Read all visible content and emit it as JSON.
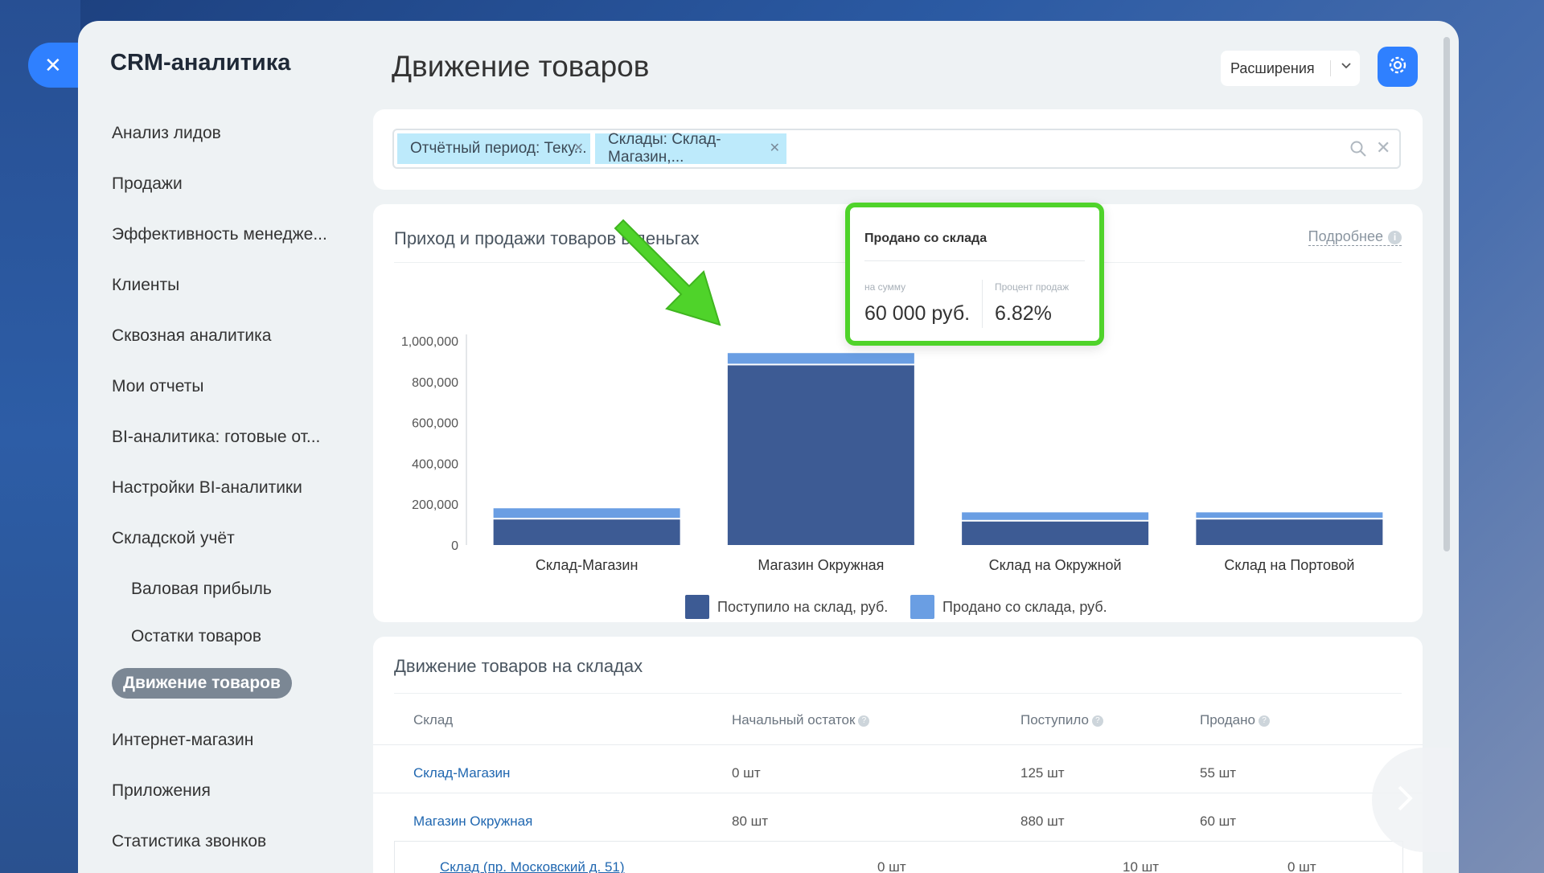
{
  "app": {
    "title": "CRM-аналитика"
  },
  "sidebar": {
    "items": [
      {
        "label": "Анализ лидов"
      },
      {
        "label": "Продажи"
      },
      {
        "label": "Эффективность менедже..."
      },
      {
        "label": "Клиенты"
      },
      {
        "label": "Сквозная аналитика"
      },
      {
        "label": "Мои отчеты"
      },
      {
        "label": "BI-аналитика: готовые от..."
      },
      {
        "label": "Настройки BI-аналитики"
      },
      {
        "label": "Складской учёт"
      },
      {
        "label": "Валовая прибыль"
      },
      {
        "label": "Остатки товаров"
      },
      {
        "label": "Движение товаров"
      },
      {
        "label": "Интернет-магазин"
      },
      {
        "label": "Приложения"
      },
      {
        "label": "Статистика звонков"
      }
    ]
  },
  "header": {
    "title": "Движение товаров",
    "extensions_label": "Расширения"
  },
  "filters": {
    "chips": [
      {
        "label": "Отчётный период: Теку..."
      },
      {
        "label": "Склады: Склад-Магазин,..."
      }
    ]
  },
  "chart_card": {
    "title": "Приход и продажи товаров в деньгах",
    "more_label": "Подробнее"
  },
  "tooltip": {
    "title": "Продано со склада",
    "sum_label": "на сумму",
    "sum_value": "60 000 руб.",
    "percent_label": "Процент продаж",
    "percent_value": "6.82%"
  },
  "chart_data": {
    "type": "bar",
    "stacked": true,
    "categories": [
      "Склад-Магазин",
      "Магазин Окружная",
      "Склад на Окружной",
      "Склад на Портовой"
    ],
    "series": [
      {
        "name": "Поступило на склад, руб.",
        "color": "#3d5b94",
        "values": [
          125000,
          880000,
          115000,
          125000
        ]
      },
      {
        "name": "Продано со склада, руб.",
        "color": "#6a9ee3",
        "values": [
          55000,
          60000,
          45000,
          35000
        ]
      }
    ],
    "y_ticks": [
      "1,000,000",
      "800,000",
      "600,000",
      "400,000",
      "200,000",
      "0"
    ],
    "ylim": [
      0,
      1000000
    ],
    "legend": "bottom"
  },
  "table": {
    "title": "Движение товаров на складах",
    "headers": [
      "Склад",
      "Начальный остаток",
      "Поступило",
      "Продано"
    ],
    "rows": [
      {
        "name": "Склад-Магазин",
        "start": "0 шт",
        "in": "125 шт",
        "sold": "55 шт"
      },
      {
        "name": "Магазин Окружная",
        "start": "80 шт",
        "in": "880 шт",
        "sold": "60 шт"
      }
    ],
    "subrow": {
      "name": "Склад (пр. Московский д. 51)",
      "start": "0 шт",
      "in": "10 шт",
      "sold": "0 шт"
    }
  },
  "colors": {
    "accent": "#2f80ff",
    "highlight": "#4fd32a"
  }
}
